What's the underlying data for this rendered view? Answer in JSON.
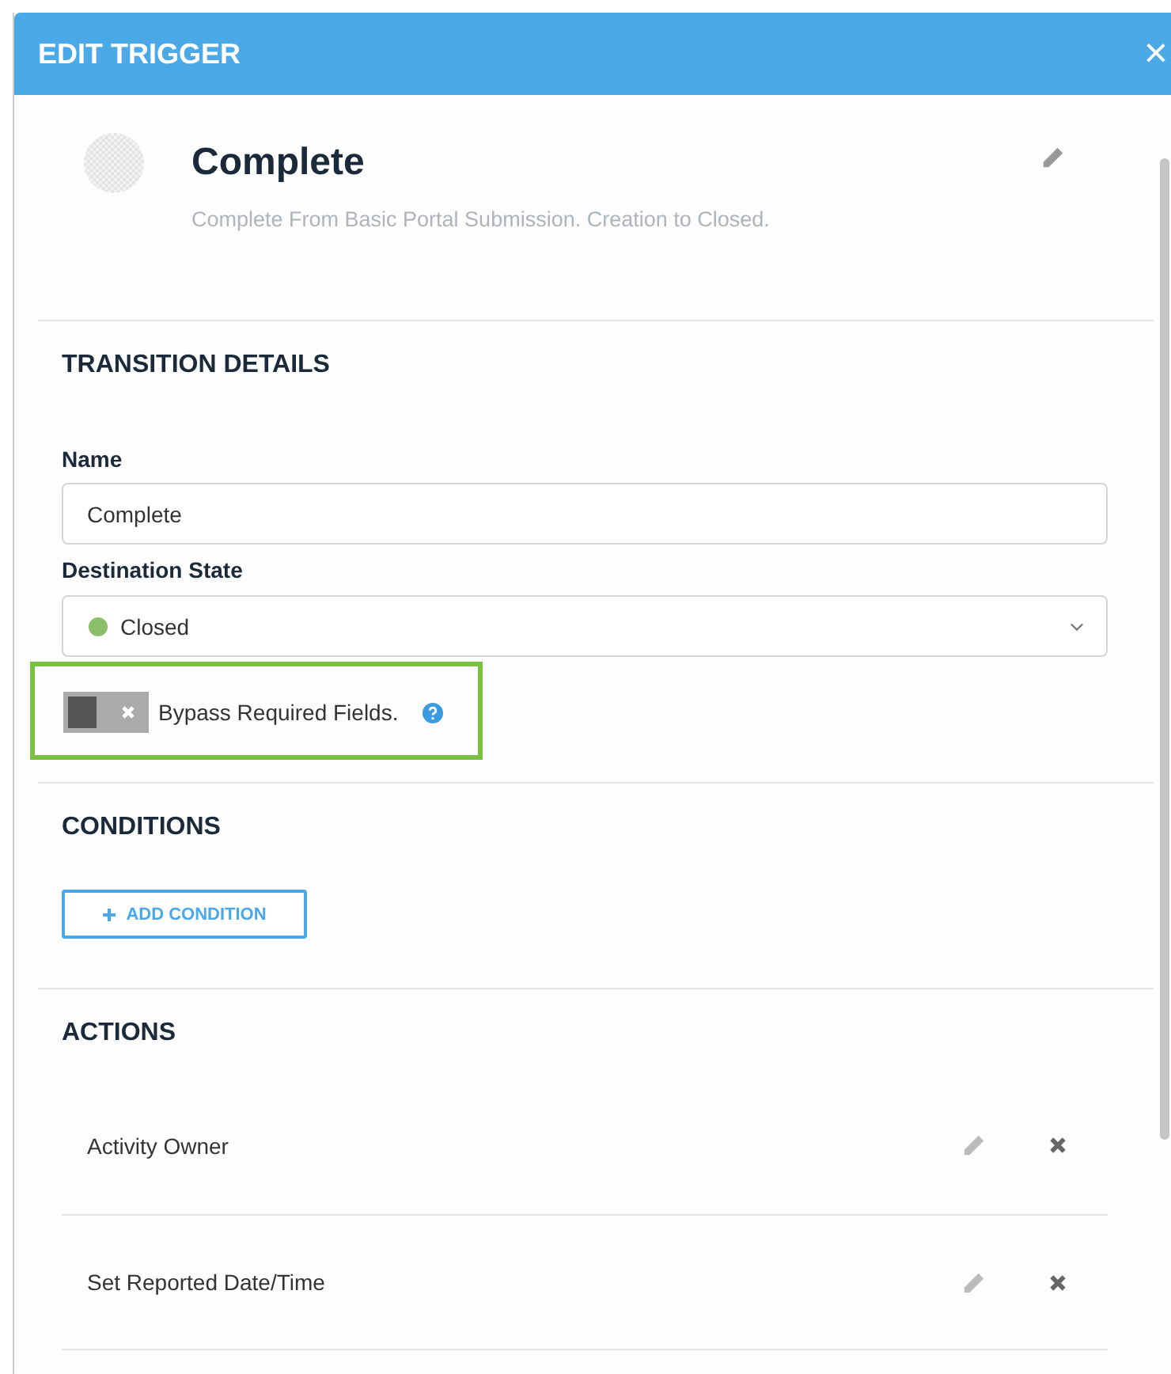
{
  "window": {
    "title": "EDIT TRIGGER",
    "close": "×"
  },
  "trigger": {
    "title": "Complete",
    "description": "Complete From Basic Portal Submission. Creation to Closed."
  },
  "transition_details": {
    "heading": "TRANSITION DETAILS",
    "name_label": "Name",
    "name_value": "Complete",
    "destination": {
      "label": "Destination State",
      "value": "Closed",
      "color": "#8bc06a"
    },
    "bypass": {
      "label": "Bypass Required Fields.",
      "on": false,
      "highlighted": true
    }
  },
  "conditions": {
    "heading": "CONDITIONS",
    "add_button": "ADD CONDITION"
  },
  "actions": {
    "heading": "ACTIONS",
    "items": [
      {
        "name": "Activity Owner"
      },
      {
        "name": "Set Reported Date/Time"
      }
    ]
  }
}
